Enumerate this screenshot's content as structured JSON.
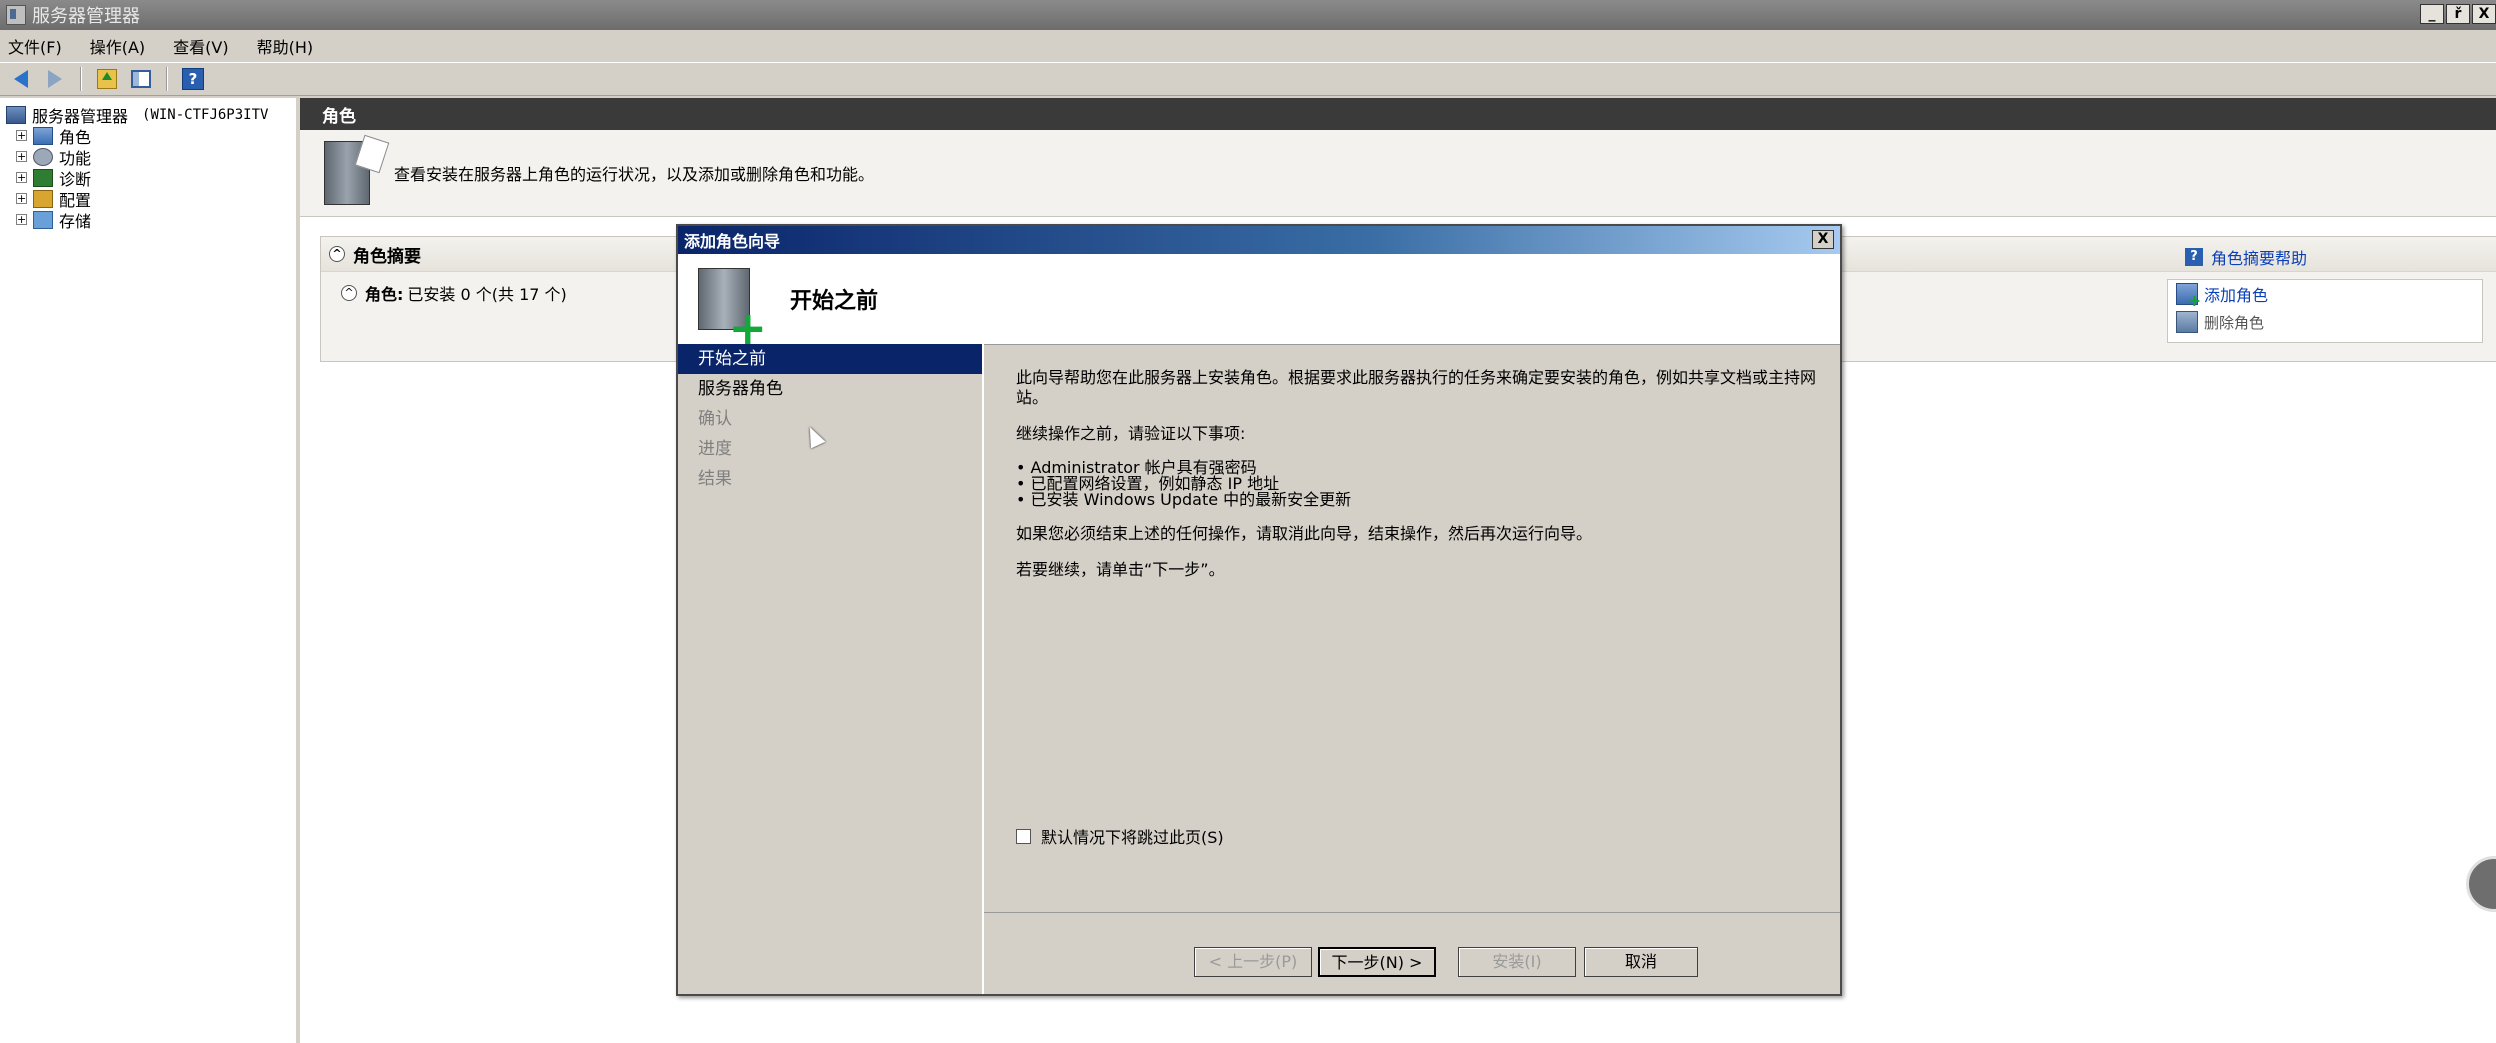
{
  "window": {
    "title": "服务器管理器",
    "buttons": [
      "_",
      "ř",
      "X"
    ]
  },
  "menubar": {
    "items": [
      "文件(F)",
      "操作(A)",
      "查看(V)",
      "帮助(H)"
    ]
  },
  "tree": {
    "root": {
      "label": "服务器管理器",
      "server": "(WIN-CTFJ6P3ITV"
    },
    "items": [
      {
        "label": "角色",
        "icon": "roles-icon"
      },
      {
        "label": "功能",
        "icon": "features-icon"
      },
      {
        "label": "诊断",
        "icon": "diagnostics-icon"
      },
      {
        "label": "配置",
        "icon": "configuration-icon"
      },
      {
        "label": "存储",
        "icon": "storage-icon"
      }
    ]
  },
  "content": {
    "header": "角色",
    "description": "查看安装在服务器上角色的运行状况，以及添加或删除角色和功能。",
    "summary": {
      "title": "角色摘要",
      "help": "角色摘要帮助",
      "row_label": "角色:",
      "row_value": "已安装 0 个(共 17 个)",
      "actions": {
        "add": "添加角色",
        "remove": "删除角色"
      }
    }
  },
  "wizard": {
    "title": "添加角色向导",
    "close": "X",
    "header_title": "开始之前",
    "nav": [
      {
        "label": "开始之前",
        "state": "active"
      },
      {
        "label": "服务器角色",
        "state": "enabled"
      },
      {
        "label": "确认",
        "state": "disabled"
      },
      {
        "label": "进度",
        "state": "disabled"
      },
      {
        "label": "结果",
        "state": "disabled"
      }
    ],
    "intro": "此向导帮助您在此服务器上安装角色。根据要求此服务器执行的任务来确定要安装的角色，例如共享文档或主持网站。",
    "verify_heading": "继续操作之前，请验证以下事项:",
    "bullets": [
      "• Administrator 帐户具有强密码",
      "• 已配置网络设置，例如静态 IP 地址",
      "• 已安装 Windows Update 中的最新安全更新"
    ],
    "cancel_note": "如果您必须结束上述的任何操作，请取消此向导，结束操作，然后再次运行向导。",
    "continue_note": "若要继续，请单击“下一步”。",
    "skip_label": "默认情况下将跳过此页(S)",
    "buttons": {
      "prev": "< 上一步(P)",
      "next": "下一步(N) >",
      "install": "安装(I)",
      "cancel": "取消"
    }
  },
  "colors": {
    "selection": "#0a246a",
    "link": "#0b3fb8",
    "header_bar": "#3a3a3a"
  }
}
